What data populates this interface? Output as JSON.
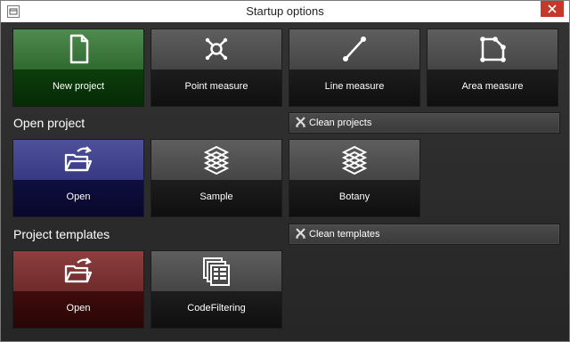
{
  "window": {
    "title": "Startup options"
  },
  "actions": [
    {
      "label": "New project",
      "icon": "new-document-icon"
    },
    {
      "label": "Point measure",
      "icon": "point-measure-icon"
    },
    {
      "label": "Line measure",
      "icon": "line-measure-icon"
    },
    {
      "label": "Area measure",
      "icon": "area-measure-icon"
    }
  ],
  "open_project": {
    "heading": "Open project",
    "clean_label": "Clean projects",
    "tiles": [
      {
        "label": "Open",
        "icon": "open-folder-icon"
      },
      {
        "label": "Sample",
        "icon": "layers-icon"
      },
      {
        "label": "Botany",
        "icon": "layers-icon"
      }
    ]
  },
  "project_templates": {
    "heading": "Project templates",
    "clean_label": "Clean templates",
    "tiles": [
      {
        "label": "Open",
        "icon": "open-folder-icon"
      },
      {
        "label": "CodeFiltering",
        "icon": "template-documents-icon"
      }
    ]
  },
  "colors": {
    "new_project_tile": "#2f6a2f",
    "open_project_tile": "#373a82",
    "open_template_tile": "#6e2a2a",
    "default_tile": "#454545",
    "close_button": "#c7382c"
  }
}
